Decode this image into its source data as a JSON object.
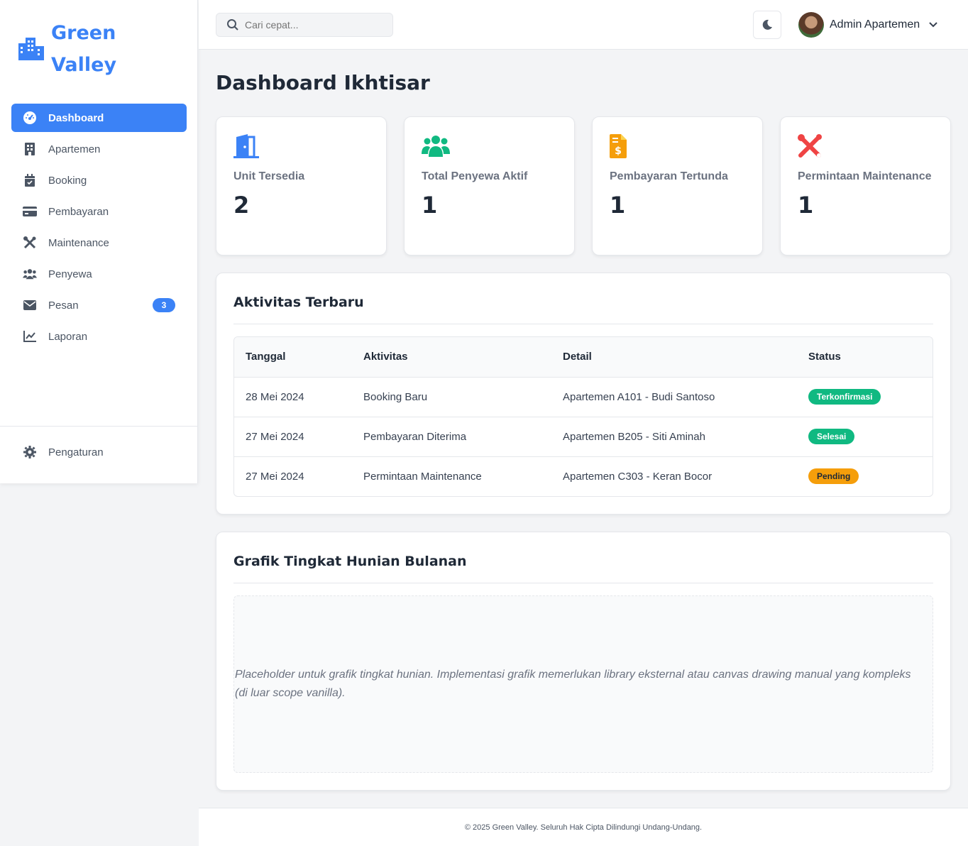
{
  "brand": {
    "name_line1": "Green",
    "name_line2": "Valley",
    "color": "#3b82f6"
  },
  "sidebar": {
    "items": [
      {
        "label": "Dashboard",
        "icon": "gauge-icon",
        "active": true
      },
      {
        "label": "Apartemen",
        "icon": "building-icon"
      },
      {
        "label": "Booking",
        "icon": "calendar-check-icon"
      },
      {
        "label": "Pembayaran",
        "icon": "credit-card-icon"
      },
      {
        "label": "Maintenance",
        "icon": "tools-icon"
      },
      {
        "label": "Penyewa",
        "icon": "users-icon"
      },
      {
        "label": "Pesan",
        "icon": "envelope-icon",
        "badge": "3"
      },
      {
        "label": "Laporan",
        "icon": "chart-line-icon"
      }
    ],
    "settings_label": "Pengaturan"
  },
  "header": {
    "search_placeholder": "Cari cepat...",
    "user_name": "Admin Apartemen"
  },
  "main": {
    "page_title": "Dashboard Ikhtisar",
    "cards": [
      {
        "label": "Unit Tersedia",
        "value": "2",
        "icon": "door-icon",
        "color": "#3b82f6"
      },
      {
        "label": "Total Penyewa Aktif",
        "value": "1",
        "icon": "users-icon",
        "color": "#10b981"
      },
      {
        "label": "Pembayaran Tertunda",
        "value": "1",
        "icon": "invoice-dollar-icon",
        "color": "#f59e0b"
      },
      {
        "label": "Permintaan Maintenance",
        "value": "1",
        "icon": "tools-icon",
        "color": "#ef4444"
      }
    ],
    "activity": {
      "title": "Aktivitas Terbaru",
      "headers": [
        "Tanggal",
        "Aktivitas",
        "Detail",
        "Status"
      ],
      "rows": [
        {
          "date": "28 Mei 2024",
          "activity": "Booking Baru",
          "detail": "Apartemen A101 - Budi Santoso",
          "status": "Terkonfirmasi",
          "status_color": "#10b981"
        },
        {
          "date": "27 Mei 2024",
          "activity": "Pembayaran Diterima",
          "detail": "Apartemen B205 - Siti Aminah",
          "status": "Selesai",
          "status_color": "#10b981"
        },
        {
          "date": "27 Mei 2024",
          "activity": "Permintaan Maintenance",
          "detail": "Apartemen C303 - Keran Bocor",
          "status": "Pending",
          "status_color": "#f59e0b"
        }
      ]
    },
    "chart_panel": {
      "title": "Grafik Tingkat Hunian Bulanan",
      "placeholder": "Placeholder untuk grafik tingkat hunian. Implementasi grafik memerlukan library eksternal atau canvas drawing manual yang kompleks (di luar scope vanilla)."
    }
  },
  "footer": {
    "text": "© 2025 Green Valley. Seluruh Hak Cipta Dilindungi Undang-Undang."
  }
}
